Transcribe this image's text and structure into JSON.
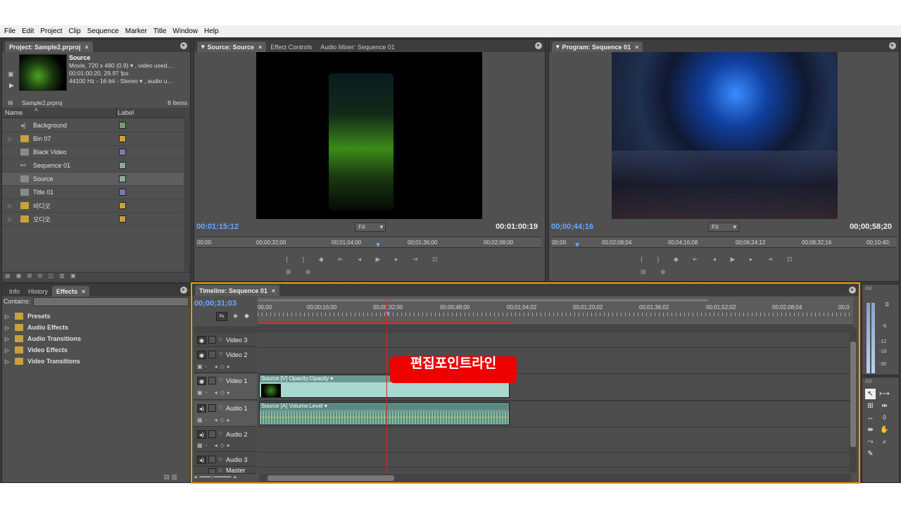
{
  "menu": [
    "File",
    "Edit",
    "Project",
    "Clip",
    "Sequence",
    "Marker",
    "Title",
    "Window",
    "Help"
  ],
  "project": {
    "tab": "Project: Sample2.prproj",
    "clip_name": "Source",
    "clip_info1": "Movie, 720 x 480 (0.9)",
    "clip_info1b": ", video used...",
    "clip_info2": "00:01:00:20, 29.97 fps",
    "clip_info3": "44100 Hz - 16-bit - Stereo",
    "clip_info3b": ", audio u...",
    "file": "Sample2.prproj",
    "count": "8 Items",
    "col_name": "Name",
    "col_label": "Label",
    "items": [
      {
        "name": "Background",
        "type": "audio",
        "label_color": "#7a9a7a"
      },
      {
        "name": "Bin 07",
        "type": "folder",
        "label_color": "#c9a13b"
      },
      {
        "name": "Black Video",
        "type": "clip",
        "label_color": "#7a7ab0"
      },
      {
        "name": "Sequence 01",
        "type": "sequence",
        "label_color": "#8aa8a0"
      },
      {
        "name": "Source",
        "type": "clip",
        "label_color": "#8aaaa0"
      },
      {
        "name": "Title 01",
        "type": "title",
        "label_color": "#7a7ab0"
      },
      {
        "name": "비디오",
        "type": "folder",
        "label_color": "#c9a13b"
      },
      {
        "name": "오디오",
        "type": "folder",
        "label_color": "#c9a13b"
      }
    ]
  },
  "effects_panel": {
    "tabs": [
      "Info",
      "History",
      "Effects"
    ],
    "contains_label": "Contains:",
    "items": [
      "Presets",
      "Audio Effects",
      "Audio Transitions",
      "Video Effects",
      "Video Transitions"
    ]
  },
  "source_monitor": {
    "tabs": [
      "Source: Source",
      "Effect Controls",
      "Audio Mixer: Sequence 01"
    ],
    "tc_current": "00:01:15:12",
    "tc_duration": "00:01:00:19",
    "fit": "Fit",
    "ruler": [
      "00;00",
      "00;00;32;00",
      "00;01;04;00",
      "00;01;36;00",
      "00;02;08;00"
    ]
  },
  "program_monitor": {
    "tab": "Program: Sequence 01",
    "tc_current": "00;00;44;16",
    "tc_duration": "00;00;58;20",
    "fit": "Fit",
    "ruler": [
      "00;00",
      "00;02;08;04",
      "00;04;16;08",
      "00;06;24;12",
      "00;08;32;16",
      "00;10;40;"
    ]
  },
  "timeline": {
    "tab": "Timeline: Sequence 01",
    "tc": "00;00;31;03",
    "ruler": [
      "00;00",
      "00;00;16;00",
      "00;00;32;00",
      "00;00;48;00",
      "00;01;04;02",
      "00;01;20;02",
      "00;01;36;02",
      "00;01;52;02",
      "00;02;08;04",
      "00;0"
    ],
    "tracks": [
      "Video 3",
      "Video 2",
      "Video 1",
      "Audio 1",
      "Audio 2",
      "Audio 3",
      "Master"
    ],
    "video_clip_label": "Source  [V]  Opacity:Opacity",
    "audio_clip_label": "Source  [A]  Volume:Level"
  },
  "annotation": "편집포인트라인",
  "meter_labels": [
    "0",
    "-6",
    "-12",
    "-18",
    "-30"
  ],
  "colors": {
    "annotation_bg": "#ee0000",
    "playhead": "#e02020",
    "clip_video": "#a8d8d0",
    "clip_audio": "#8ab8a8",
    "timecode": "#6aa8ff",
    "panel_highlight": "#e8a000"
  }
}
